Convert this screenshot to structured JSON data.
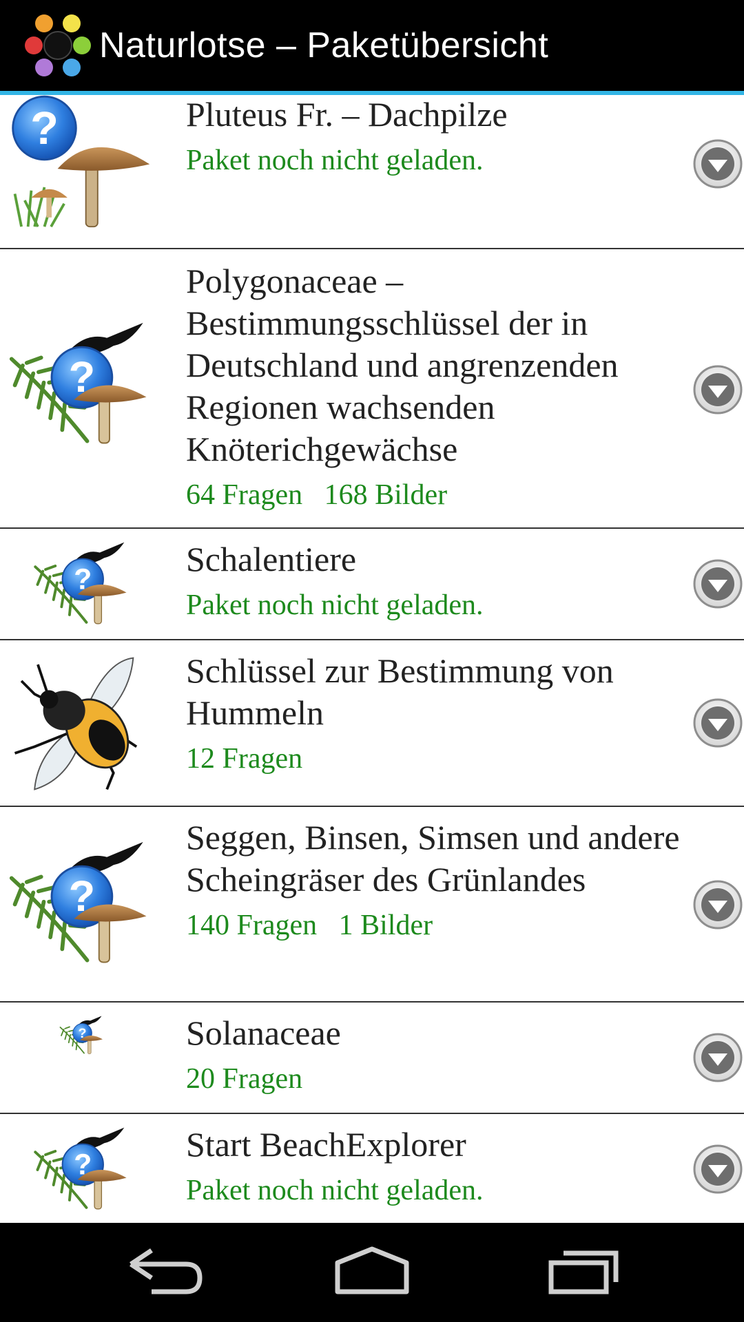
{
  "app": {
    "title": "Naturlotse – Paketübersicht",
    "accent": "#33b5e5",
    "status_color": "#1d8a1d"
  },
  "packages": [
    {
      "title": "Pluteus Fr. – Dachpilze",
      "status": "Paket noch nicht geladen.",
      "icon": "mushroom-question-icon"
    },
    {
      "title": "Polygonaceae – Bestimmungsschlüssel der in Deutschland und angrenzenden Regionen wachsenden Knöterichgewächse",
      "status": "64 Fragen   168 Bilder",
      "icon": "nature-default-icon"
    },
    {
      "title": "Schalentiere",
      "status": "Paket noch nicht geladen.",
      "icon": "nature-default-icon"
    },
    {
      "title": "Schlüssel zur Bestimmung von Hummeln",
      "status": "12 Fragen",
      "icon": "bumblebee-icon"
    },
    {
      "title": "Seggen, Binsen, Simsen und andere Scheingräser des Grünlandes",
      "status": "140 Fragen   1 Bilder",
      "icon": "nature-default-icon"
    },
    {
      "title": "Solanaceae",
      "status": "20 Fragen",
      "icon": "nature-default-small-icon"
    },
    {
      "title": "Start BeachExplorer",
      "status": "Paket noch nicht geladen.",
      "icon": "nature-default-icon"
    }
  ],
  "navigation": {
    "back": "back-icon",
    "home": "home-icon",
    "recents": "recent-apps-icon"
  }
}
